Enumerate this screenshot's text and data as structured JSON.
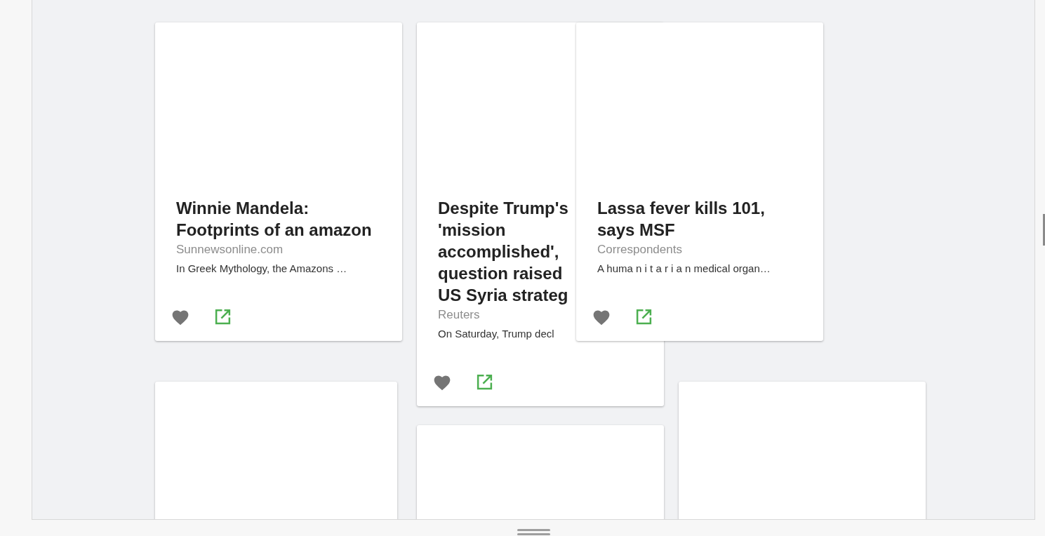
{
  "cards": [
    {
      "kind": "article",
      "title": "Winnie Mandela: Footprints of an amazon",
      "source": "Sunnewsonline.com",
      "description": "In Greek Mythology, the Amazons …",
      "clipped": false
    },
    {
      "kind": "article",
      "title": "Despite Trump's\n'mission\naccomplished',\nquestion raised\nUS Syria strateg",
      "source": "Reuters",
      "description": "On Saturday, Trump decl",
      "clipped": true
    },
    {
      "kind": "article",
      "title": "Lassa fever kills 101, says MSF",
      "source": "Correspondents",
      "description": "A huma n i t a r i a n medical organ…",
      "clipped": false
    },
    {
      "kind": "empty"
    },
    {
      "kind": "empty"
    },
    {
      "kind": "empty"
    }
  ]
}
